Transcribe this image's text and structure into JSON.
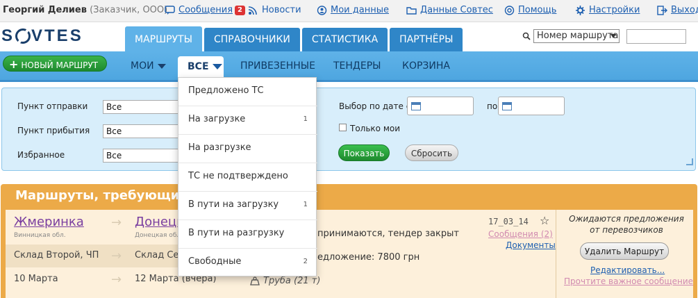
{
  "topbar": {
    "user_name": "Георгий Делиев",
    "user_role": "(Заказчик, ООО)",
    "links": [
      {
        "label": "Сообщения",
        "badge": "2"
      },
      {
        "label": "Новости"
      },
      {
        "label": "Мои данные"
      },
      {
        "label": "Данные Совтес"
      },
      {
        "label": "Помощь"
      },
      {
        "label": "Настройки"
      },
      {
        "label": "Выход"
      }
    ]
  },
  "logo": {
    "parts": [
      "S",
      "VTES"
    ]
  },
  "tabs": [
    {
      "label": "Маршруты",
      "active": true
    },
    {
      "label": "Справочники"
    },
    {
      "label": "Статистика"
    },
    {
      "label": "Партнёры"
    }
  ],
  "search": {
    "select_value": "Номер маршрута",
    "input_value": ""
  },
  "subnav": {
    "new_route": "НОВЫЙ МАРШРУТ",
    "items": [
      "МОИ",
      "ВСЕ",
      "ПРИВЕЗЕННЫЕ",
      "ТЕНДЕРЫ",
      "КОРЗИНА"
    ]
  },
  "dropdown": {
    "items": [
      {
        "label": "Предложено ТС",
        "count": ""
      },
      {
        "label": "На загрузке",
        "count": "1"
      },
      {
        "label": "На разгрузке",
        "count": ""
      },
      {
        "label": "ТС не подтверждено",
        "count": ""
      },
      {
        "label": "В пути на загрузку",
        "count": "1"
      },
      {
        "label": "В пути на разгрузку",
        "count": ""
      },
      {
        "label": "Свободные",
        "count": "2"
      }
    ]
  },
  "filter": {
    "origin_label": "Пункт отправки",
    "origin_value": "Все",
    "dest_label": "Пункт прибытия",
    "dest_value": "Все",
    "fav_label": "Избранное",
    "fav_value": "Все",
    "date_label": "Выбор по дате с",
    "date_to_label": "по",
    "only_mine_label": "Только мои",
    "show_button": "Показать",
    "reset_button": "Сбросить"
  },
  "routes": {
    "title": "Маршруты, требующие в",
    "card": {
      "from_city": "Жмеринка",
      "from_region": "Винницкая обл.",
      "to_city": "Донецк",
      "to_region": "Донецкая обл",
      "from_warehouse": "Склад Второй, ЧП",
      "to_warehouse": "Склад Сед",
      "from_date": "10 Марта",
      "to_date": "12 Марта (вчера)",
      "status": "принимаются, тендер закрыт",
      "offer": "едложение: 7800 грн",
      "cargo": "Труба (21 т)",
      "date_code": "17_03_14",
      "messages_link": "Сообщения (2)",
      "docs_link": "Документы",
      "waiting": "Ожидаются предложения от перевозчиков",
      "delete_button": "Удалить Маршрут",
      "edit_link": "Редактировать...",
      "important_link": "Прочтите важное сообщение"
    }
  },
  "colors": {
    "accent": "#2f86c8",
    "tab_active": "#5fb2e8",
    "green": "#1e8a2e",
    "orange": "#ecaa48"
  }
}
